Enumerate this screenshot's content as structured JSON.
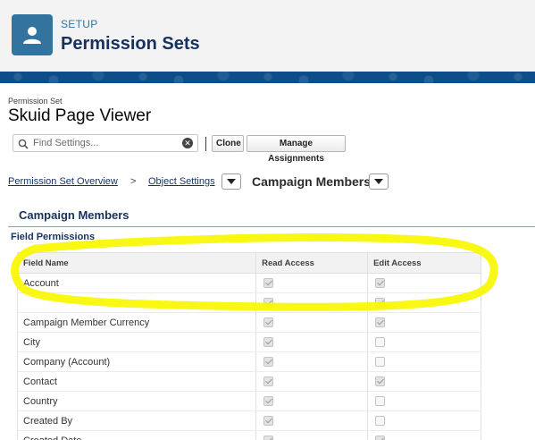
{
  "header": {
    "eyebrow": "SETUP",
    "title": "Permission Sets",
    "icon": "user-icon"
  },
  "permission_set": {
    "eyebrow": "Permission Set",
    "title": "Skuid Page Viewer"
  },
  "toolbar": {
    "search_placeholder": "Find Settings...",
    "clone_label": "Clone",
    "manage_label": "Manage Assignments"
  },
  "breadcrumb": {
    "overview": "Permission Set Overview",
    "separator": ">",
    "object_settings": "Object Settings",
    "current": "Campaign Members"
  },
  "section": {
    "title": "Campaign Members",
    "subtitle": "Field Permissions"
  },
  "table": {
    "headers": [
      "Field Name",
      "Read Access",
      "Edit Access"
    ],
    "rows": [
      {
        "name": "Account",
        "read": true,
        "edit": true
      },
      {
        "name": "",
        "read": true,
        "edit": true
      },
      {
        "name": "Campaign Member Currency",
        "read": true,
        "edit": true
      },
      {
        "name": "City",
        "read": true,
        "edit": false
      },
      {
        "name": "Company (Account)",
        "read": true,
        "edit": false
      },
      {
        "name": "Contact",
        "read": true,
        "edit": true
      },
      {
        "name": "Country",
        "read": true,
        "edit": false
      },
      {
        "name": "Created By",
        "read": true,
        "edit": false
      },
      {
        "name": "Created Date",
        "read": true,
        "edit": true
      }
    ]
  },
  "colors": {
    "brand_blue": "#0e4d8a",
    "icon_blue": "#33749f",
    "highlight": "#f7f700"
  }
}
